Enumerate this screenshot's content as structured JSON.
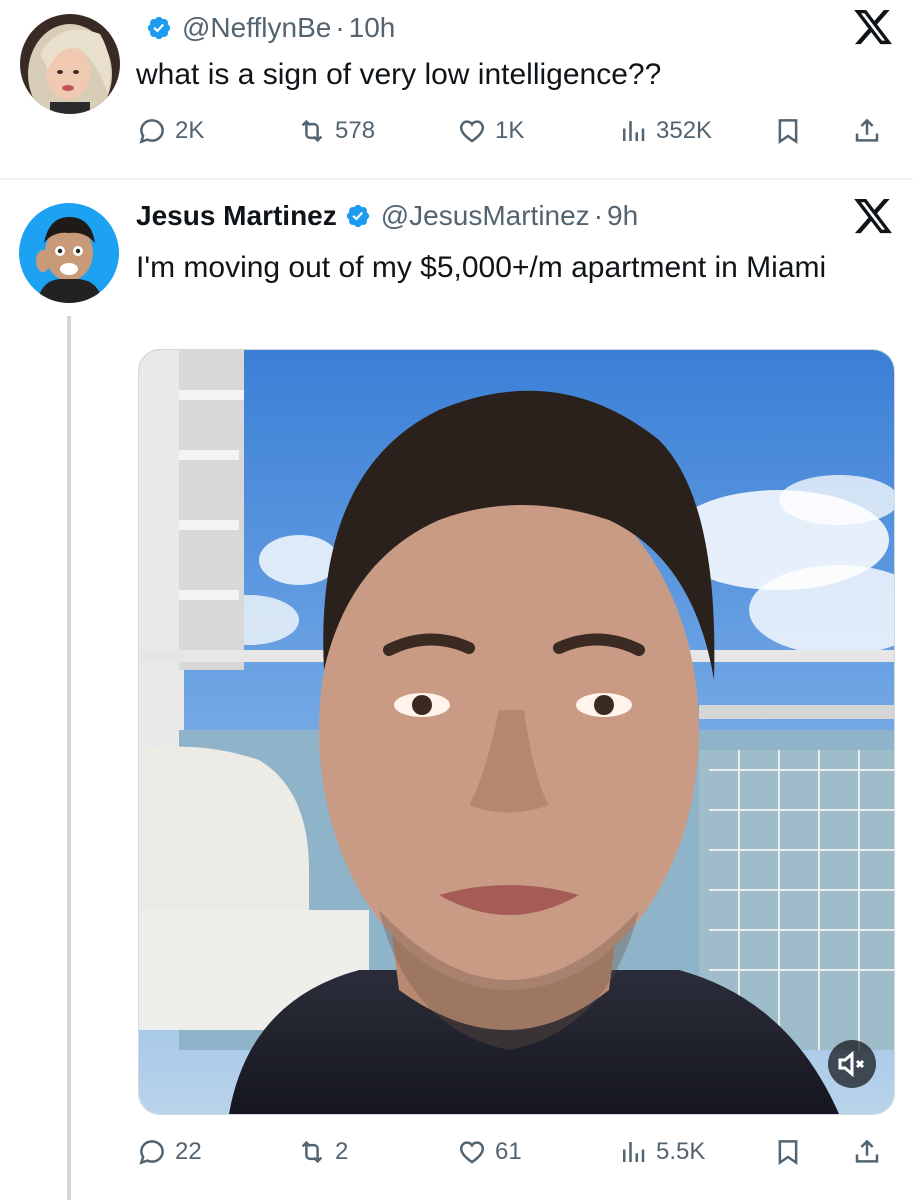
{
  "post1": {
    "handle": "@NefflynBe",
    "separator": "·",
    "time": "10h",
    "text": "what is a sign of very low intelligence??",
    "actions": {
      "replies": "2K",
      "reposts": "578",
      "likes": "1K",
      "views": "352K"
    }
  },
  "post2": {
    "name": "Jesus Martinez",
    "handle": "@JesusMartinez",
    "separator": "·",
    "time": "9h",
    "text": "I'm moving out of my $5,000+/m apartment in Miami",
    "actions": {
      "replies": "22",
      "reposts": "2",
      "likes": "61",
      "views": "5.5K"
    }
  },
  "icons": {
    "verified": "verified-badge-icon",
    "platform": "x-logo-icon",
    "reply": "reply-icon",
    "repost": "repost-icon",
    "like": "heart-icon",
    "views": "views-icon",
    "bookmark": "bookmark-icon",
    "share": "share-icon",
    "mute": "speaker-muted-icon"
  },
  "colors": {
    "verified": "#1d9bf0",
    "muted_text": "#536471",
    "text": "#0f1419",
    "divider": "#eff3f4",
    "thread": "#cfd9de"
  }
}
